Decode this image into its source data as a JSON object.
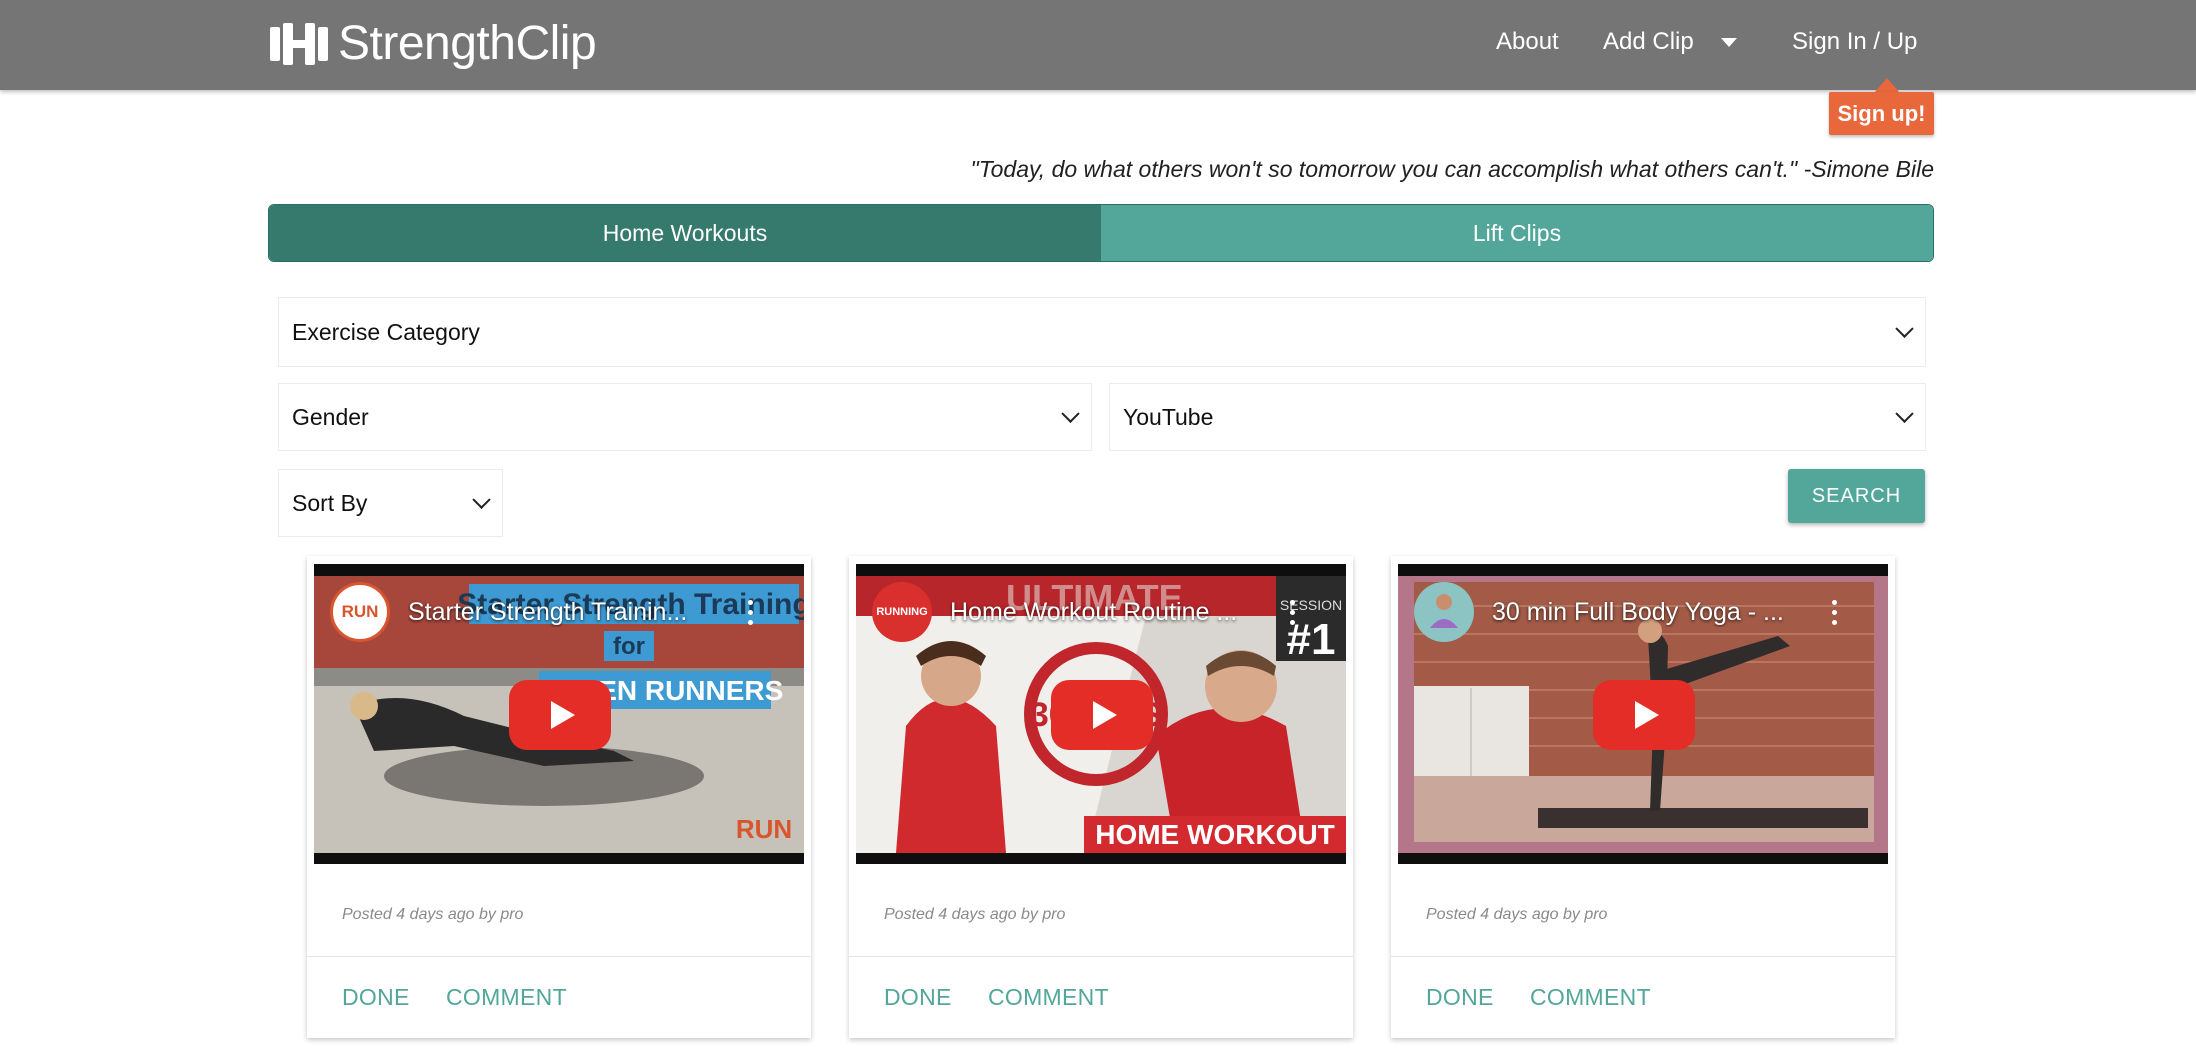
{
  "navbar": {
    "brand": "StrengthClip",
    "brand_icon": "dumbbell-icon",
    "links": {
      "about": "About",
      "add_clip": "Add Clip",
      "sign_in": "Sign In / Up"
    },
    "caret_icon": "caret-down-icon",
    "background": "#757575"
  },
  "tooltip": {
    "label": "Sign up!",
    "color": "#e8673b"
  },
  "quote": "\"Today, do what others won't so tomorrow you can accomplish what others can't.\" -Simone Bile",
  "tabs": [
    {
      "label": "Home Workouts",
      "active": true
    },
    {
      "label": "Lift Clips",
      "active": false
    }
  ],
  "filters": {
    "category": "Exercise Category",
    "gender": "Gender",
    "source": "YouTube",
    "sort": "Sort By",
    "search_button": "SEARCH"
  },
  "cards": [
    {
      "video_title": "Starter Strength Trainin...",
      "channel_badge": "RUN",
      "thumb_text_1": "Starter Strength Training",
      "thumb_text_2": "for",
      "thumb_text_3": "WOMEN RUNNERS",
      "thumb_corner": "RUN",
      "posted": "Posted 4 days ago by pro",
      "done": "DONE",
      "comment": "COMMENT"
    },
    {
      "video_title": "Home Workout Routine ...",
      "channel_badge": "RUNNING",
      "thumb_text_1": "ULTIMATE",
      "thumb_text_2": "SESSION",
      "thumb_text_3": "#1",
      "thumb_text_4": "HOME WORKOUT",
      "thumb_text_5": "30 MINS",
      "posted": "Posted 4 days ago by pro",
      "done": "DONE",
      "comment": "COMMENT"
    },
    {
      "video_title": "30 min Full Body Yoga - ...",
      "channel_badge": "",
      "posted": "Posted 4 days ago by pro",
      "done": "DONE",
      "comment": "COMMENT"
    }
  ],
  "colors": {
    "teal": "#52a69a",
    "teal_dark": "#357a6d",
    "youtube_red": "#e52d27"
  }
}
